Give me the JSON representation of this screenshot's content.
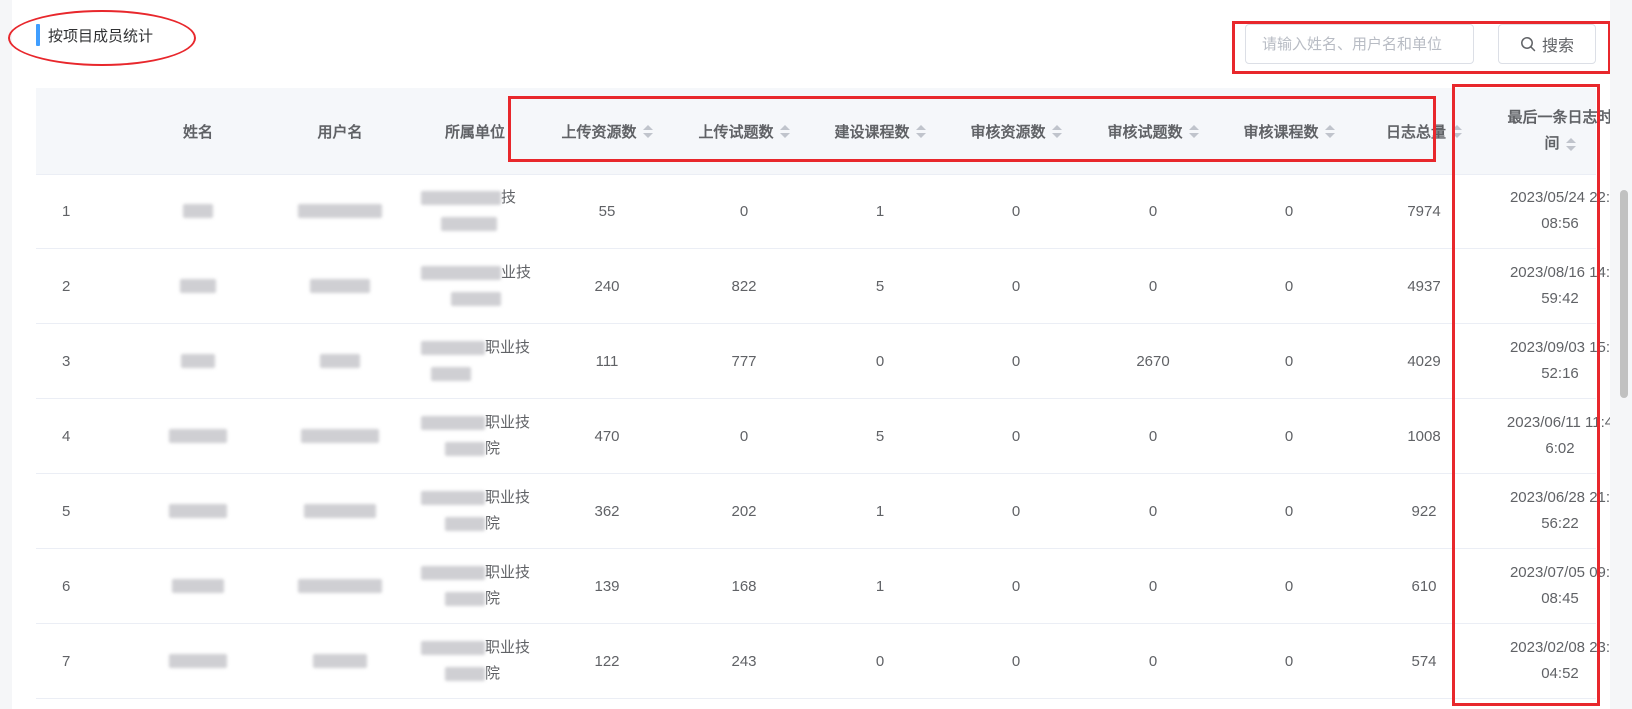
{
  "section": {
    "title": "按项目成员统计"
  },
  "search": {
    "placeholder": "请输入姓名、用户名和单位",
    "button_label": "搜索",
    "icon": "search-icon"
  },
  "colors": {
    "accent": "#409eff",
    "annotation": "#e8272c",
    "header_bg": "#f5f7fa"
  },
  "table": {
    "columns": {
      "name": "姓名",
      "username": "用户名",
      "unit": "所属单位",
      "upload_resources": "上传资源数",
      "upload_questions": "上传试题数",
      "build_courses": "建设课程数",
      "review_resources": "审核资源数",
      "review_questions": "审核试题数",
      "review_courses": "审核课程数",
      "log_total": "日志总量",
      "last_log_line1": "最后一条日志时",
      "last_log_line2": "间"
    },
    "rows": [
      {
        "index": "1",
        "unit_a": "技",
        "unit_b": "",
        "upload_resources": "55",
        "upload_questions": "0",
        "build_courses": "1",
        "review_resources": "0",
        "review_questions": "0",
        "review_courses": "0",
        "log_total": "7974",
        "last_log_a": "2023/05/24 22:",
        "last_log_b": "08:56"
      },
      {
        "index": "2",
        "unit_a": "业技",
        "unit_b": "",
        "upload_resources": "240",
        "upload_questions": "822",
        "build_courses": "5",
        "review_resources": "0",
        "review_questions": "0",
        "review_courses": "0",
        "log_total": "4937",
        "last_log_a": "2023/08/16 14:",
        "last_log_b": "59:42"
      },
      {
        "index": "3",
        "unit_a": "职业技",
        "unit_b": "",
        "upload_resources": "111",
        "upload_questions": "777",
        "build_courses": "0",
        "review_resources": "0",
        "review_questions": "2670",
        "review_courses": "0",
        "log_total": "4029",
        "last_log_a": "2023/09/03 15:",
        "last_log_b": "52:16"
      },
      {
        "index": "4",
        "unit_a": "职业技",
        "unit_b": "院",
        "upload_resources": "470",
        "upload_questions": "0",
        "build_courses": "5",
        "review_resources": "0",
        "review_questions": "0",
        "review_courses": "0",
        "log_total": "1008",
        "last_log_a": "2023/06/11 11:4",
        "last_log_b": "6:02"
      },
      {
        "index": "5",
        "unit_a": "职业技",
        "unit_b": "院",
        "upload_resources": "362",
        "upload_questions": "202",
        "build_courses": "1",
        "review_resources": "0",
        "review_questions": "0",
        "review_courses": "0",
        "log_total": "922",
        "last_log_a": "2023/06/28 21:",
        "last_log_b": "56:22"
      },
      {
        "index": "6",
        "unit_a": "职业技",
        "unit_b": "院",
        "upload_resources": "139",
        "upload_questions": "168",
        "build_courses": "1",
        "review_resources": "0",
        "review_questions": "0",
        "review_courses": "0",
        "log_total": "610",
        "last_log_a": "2023/07/05 09:",
        "last_log_b": "08:45"
      },
      {
        "index": "7",
        "unit_a": "职业技",
        "unit_b": "院",
        "upload_resources": "122",
        "upload_questions": "243",
        "build_courses": "0",
        "review_resources": "0",
        "review_questions": "0",
        "review_courses": "0",
        "log_total": "574",
        "last_log_a": "2023/02/08 23:",
        "last_log_b": "04:52"
      }
    ]
  }
}
